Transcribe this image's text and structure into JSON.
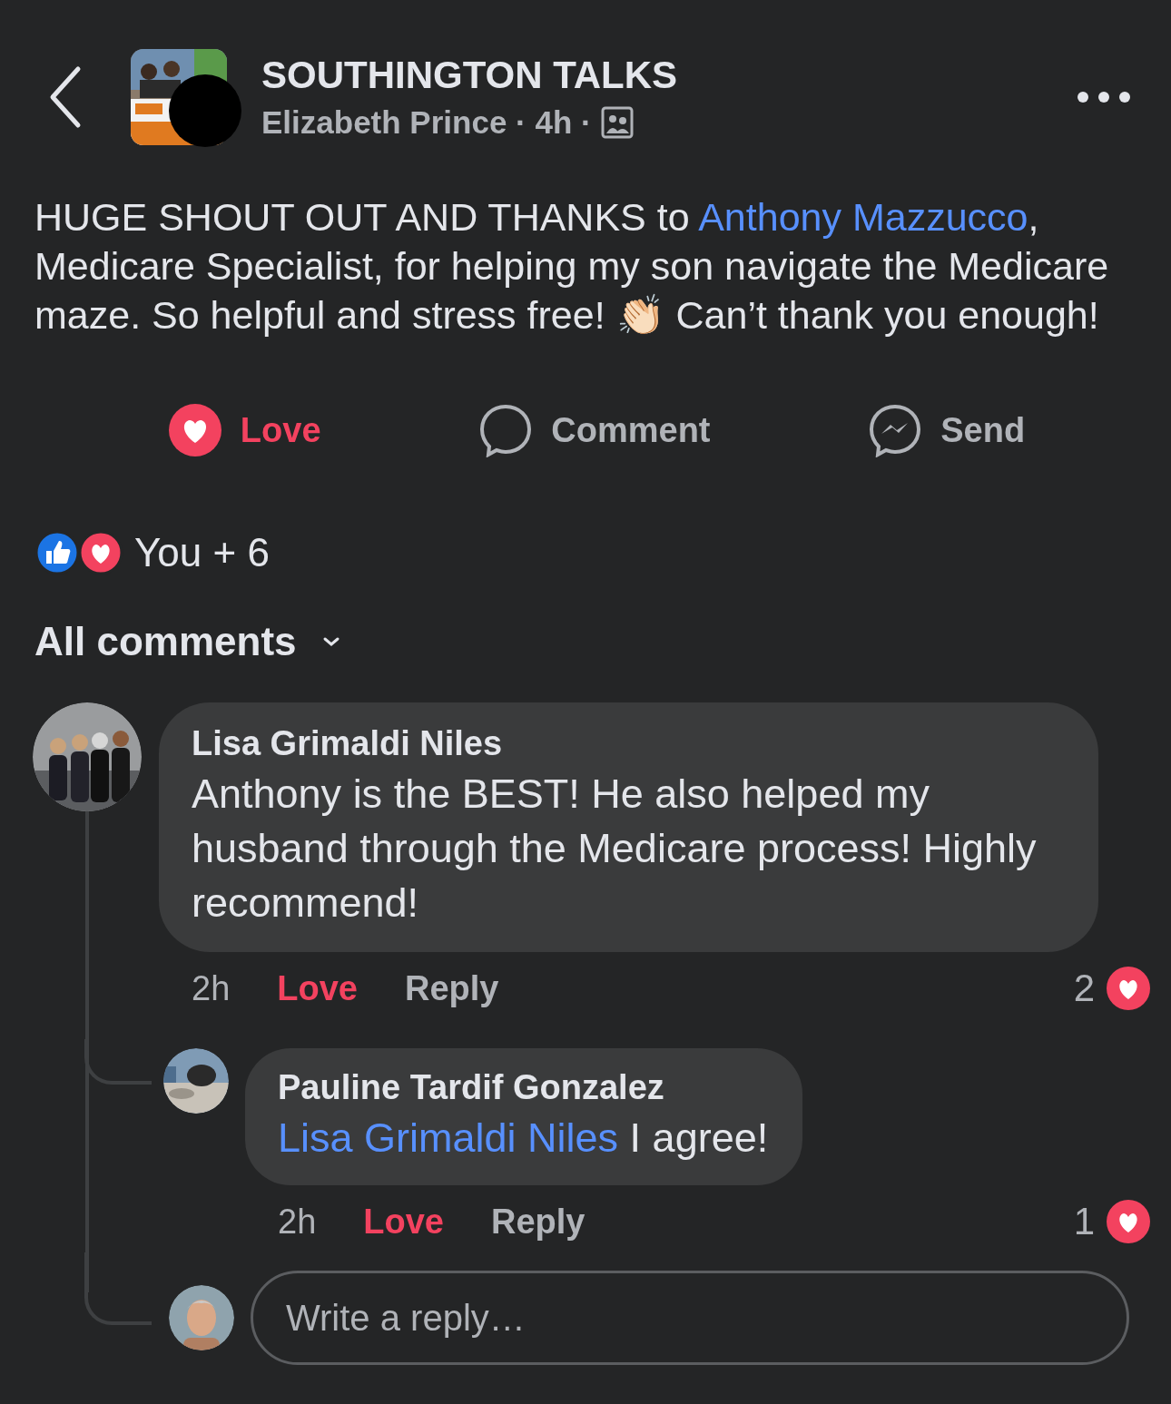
{
  "header": {
    "group_name": "SOUTHINGTON TALKS",
    "meta": "Elizabeth Prince · 4h ·"
  },
  "post": {
    "parts": [
      {
        "kind": "text",
        "text": "HUGE SHOUT OUT AND THANKS to "
      },
      {
        "kind": "link",
        "text": "Anthony Mazzucco"
      },
      {
        "kind": "text",
        "text": ", Medicare Specialist, for helping my son navigate the Medicare maze. So helpful and stress free! 👏🏻 Can’t thank you enough!"
      }
    ]
  },
  "actions": [
    {
      "kind": "love",
      "label": "Love",
      "selected": true
    },
    {
      "kind": "comment",
      "label": "Comment",
      "selected": false
    },
    {
      "kind": "send",
      "label": "Send",
      "selected": false
    }
  ],
  "reactions": {
    "summary": "You + 6"
  },
  "comments_filter": "All comments",
  "comments": [
    {
      "author": "Lisa Grimaldi Niles",
      "parts": [
        {
          "kind": "text",
          "text": "Anthony is the BEST! He also helped my husband through the Medicare process! Highly recommend!"
        }
      ],
      "time": "2h",
      "love_label": "Love",
      "loved": true,
      "reply_label": "Reply",
      "reaction_count": "2",
      "replies": [
        {
          "author": "Pauline Tardif Gonzalez",
          "parts": [
            {
              "kind": "link",
              "text": "Lisa Grimaldi Niles"
            },
            {
              "kind": "text",
              "text": " I agree!"
            }
          ],
          "time": "2h",
          "love_label": "Love",
          "loved": true,
          "reply_label": "Reply",
          "reaction_count": "1"
        }
      ]
    }
  ],
  "reply_box": {
    "placeholder": "Write a reply…"
  }
}
